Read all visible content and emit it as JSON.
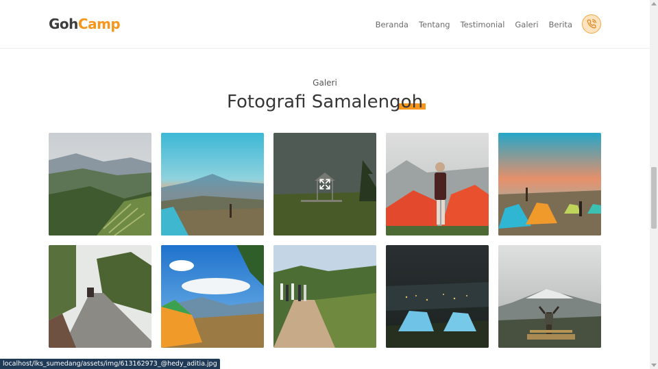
{
  "brand": {
    "part1": "Goh",
    "part2": "Camp"
  },
  "nav": {
    "items": [
      {
        "label": "Beranda"
      },
      {
        "label": "Tentang"
      },
      {
        "label": "Testimonial"
      },
      {
        "label": "Galeri"
      },
      {
        "label": "Berita"
      }
    ],
    "phone_icon": "phone-icon"
  },
  "section": {
    "label": "Galeri",
    "title": "Fotografi Samalengoh"
  },
  "gallery": {
    "hovered_index": 2,
    "hover_icon": "expand-icon"
  },
  "status_bar": {
    "url": "localhost/lks_sumedang/assets/img/613162973_@hedy_aditia.jpg"
  },
  "colors": {
    "accent": "#f5961d",
    "text_dark": "#363636",
    "status_bg": "#1f3a57"
  }
}
